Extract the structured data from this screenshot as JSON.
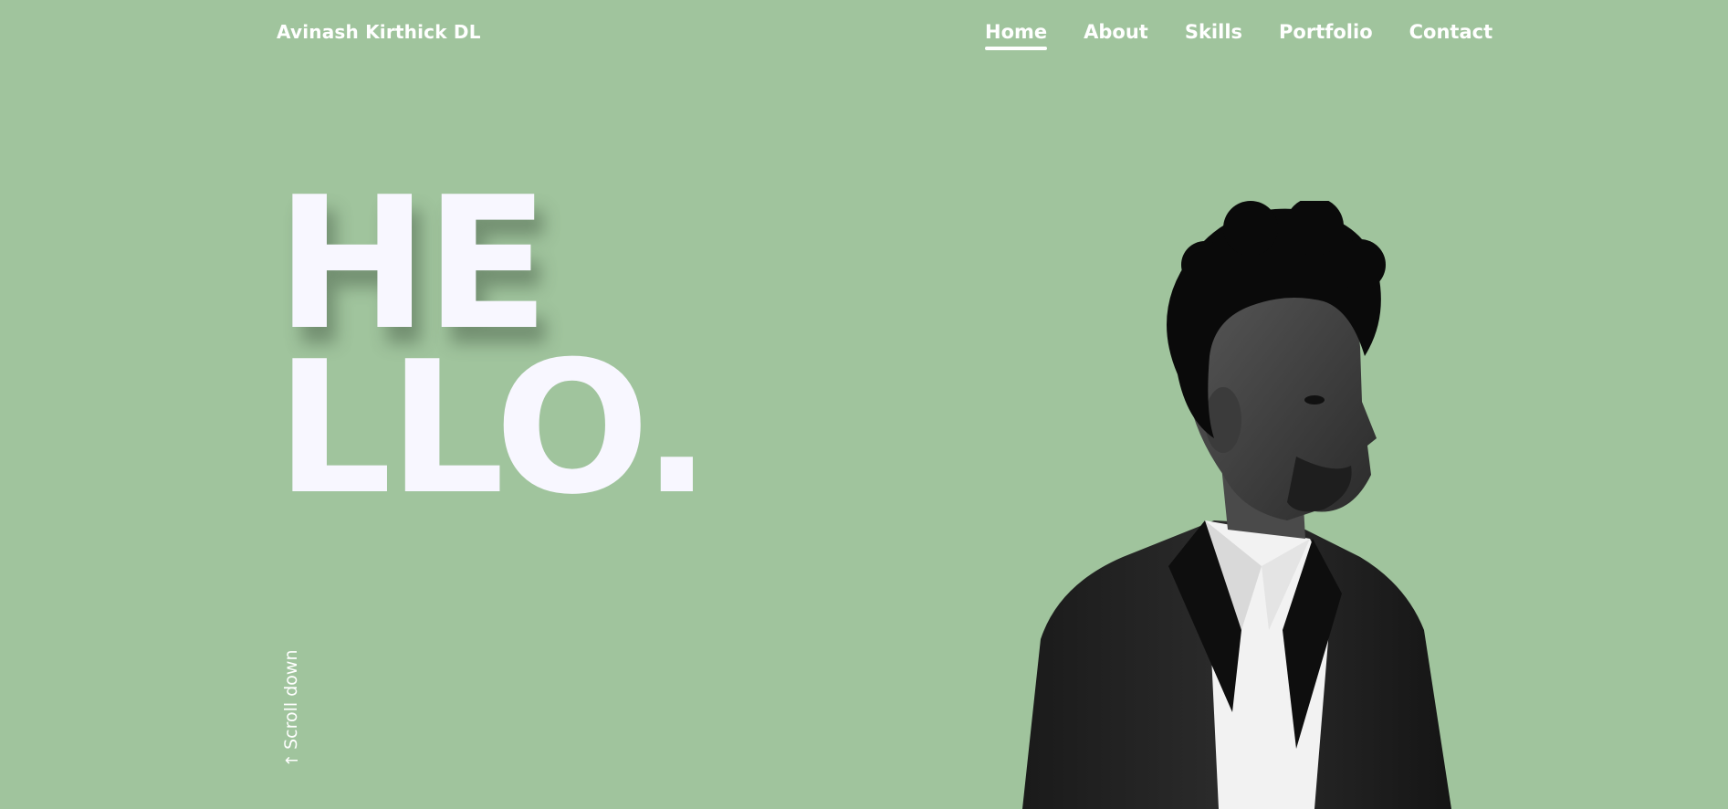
{
  "header": {
    "brand": "Avinash Kirthick DL",
    "nav": [
      {
        "label": "Home",
        "active": true
      },
      {
        "label": "About",
        "active": false
      },
      {
        "label": "Skills",
        "active": false
      },
      {
        "label": "Portfolio",
        "active": false
      },
      {
        "label": "Contact",
        "active": false
      }
    ]
  },
  "hero": {
    "line1": "HE",
    "line2": "LLO."
  },
  "scroll": {
    "label": "Scroll down",
    "icon": "arrow-down-icon"
  },
  "colors": {
    "background": "#a0c49d",
    "text": "#ffffff"
  }
}
